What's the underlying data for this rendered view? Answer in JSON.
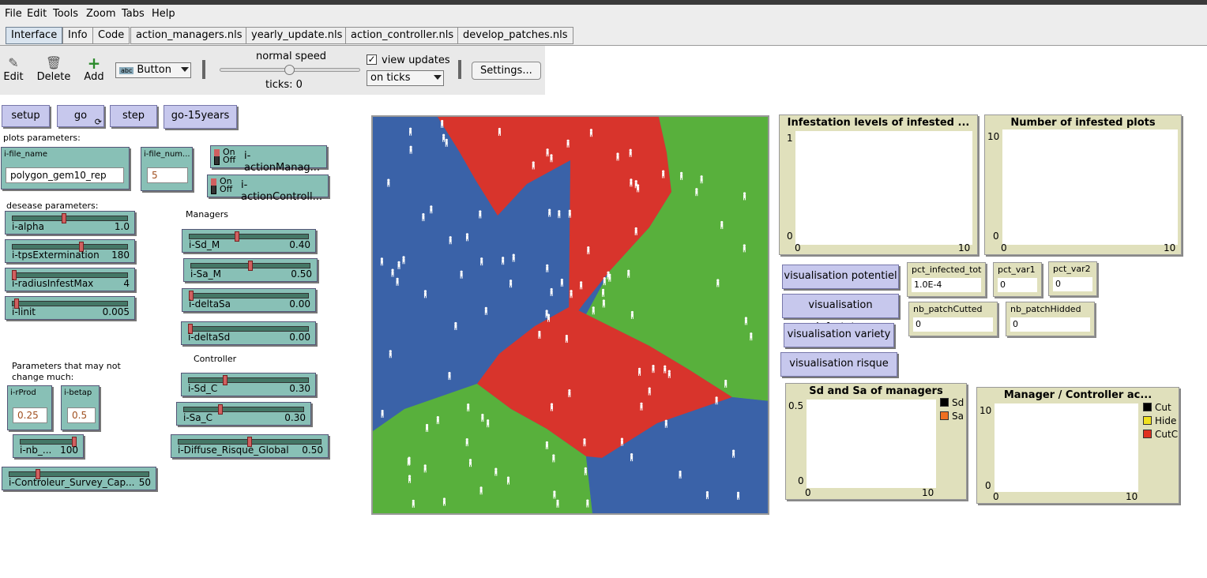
{
  "menu": [
    "File",
    "Edit",
    "Tools",
    "Zoom",
    "Tabs",
    "Help"
  ],
  "tabs": [
    "Interface",
    "Info",
    "Code",
    "action_managers.nls",
    "yearly_update.nls",
    "action_controller.nls",
    "develop_patches.nls"
  ],
  "toolbar": {
    "edit": "Edit",
    "delete": "Delete",
    "add": "Add",
    "widget_type": "Button",
    "speed_label": "normal speed",
    "ticks_label": "ticks: 0",
    "view_updates": "view updates",
    "update_mode": "on ticks",
    "settings": "Settings..."
  },
  "buttons": {
    "setup": "setup",
    "go": "go",
    "step": "step",
    "go15": "go-15years"
  },
  "labels": {
    "plots_params": "plots parameters:",
    "desease_params": "desease parameters:",
    "managers": "Managers",
    "controller": "Controller",
    "params_not_change_1": "Parameters that may not",
    "params_not_change_2": "change much:"
  },
  "chooser": {
    "title": "i-file_name",
    "value": "polygon_gem10_rep"
  },
  "inputs": [
    {
      "title": "i-file_num...",
      "value": "5"
    },
    {
      "title": "i-rProd",
      "value": "0.25"
    },
    {
      "title": "i-betap",
      "value": "0.5"
    }
  ],
  "switches": [
    {
      "on": "On",
      "off": "Off",
      "name": "i-actionManag..."
    },
    {
      "on": "On",
      "off": "Off",
      "name": "i-actionControll..."
    }
  ],
  "sliders": {
    "alpha": {
      "name": "i-alpha",
      "value": "1.0",
      "pos": 0.45
    },
    "tps": {
      "name": "i-tpsExtermination",
      "value": "180",
      "pos": 0.6
    },
    "radius": {
      "name": "i-radiusInfestMax",
      "value": "4",
      "pos": 0.0
    },
    "linit": {
      "name": "i-linit",
      "value": "0.005",
      "pos": 0.02
    },
    "sdm": {
      "name": "i-Sd_M",
      "value": "0.40",
      "pos": 0.4
    },
    "sam": {
      "name": "i-Sa_M",
      "value": "0.50",
      "pos": 0.5
    },
    "deltasa": {
      "name": "i-deltaSa",
      "value": "0.00",
      "pos": 0.0
    },
    "deltasd": {
      "name": "i-deltaSd",
      "value": "0.00",
      "pos": 0.0
    },
    "sdc": {
      "name": "i-Sd_C",
      "value": "0.30",
      "pos": 0.3
    },
    "sac": {
      "name": "i-Sa_C",
      "value": "0.30",
      "pos": 0.3
    },
    "diffuse": {
      "name": "i-Diffuse_Risque_Global",
      "value": "0.50",
      "pos": 0.5
    },
    "nb": {
      "name": "i-nb_...",
      "value": "100",
      "pos": 1.0
    },
    "survey": {
      "name": "i-Controleur_Survey_Cap...",
      "value": "50",
      "pos": 0.2
    }
  },
  "plots": {
    "infest": {
      "title": "Infestation levels of infested ...",
      "ymax": "1",
      "ymin": "0",
      "xmin": "0",
      "xmax": "10"
    },
    "number": {
      "title": "Number of infested plots",
      "ymax": "10",
      "ymin": "0",
      "xmin": "0",
      "xmax": "10"
    },
    "sdsa": {
      "title": "Sd and Sa of managers",
      "ymax": "0.5",
      "ymin": "0",
      "xmin": "0",
      "xmax": "10",
      "legend": [
        {
          "name": "Sd",
          "color": "#000000"
        },
        {
          "name": "Sa",
          "color": "#f07020"
        }
      ]
    },
    "actions": {
      "title": "Manager / Controller ac...",
      "ymax": "10",
      "ymin": "0",
      "xmin": "0",
      "xmax": "10",
      "legend": [
        {
          "name": "Cut",
          "color": "#000000"
        },
        {
          "name": "Hide",
          "color": "#f0e020"
        },
        {
          "name": "CutC",
          "color": "#e03020"
        }
      ]
    }
  },
  "vis_buttons": [
    "visualisation potentiel",
    "visualisation Infestat...",
    "visualisation variety",
    "visualisation risque"
  ],
  "monitors": [
    {
      "title": "pct_infected_tot",
      "value": "1.0E-4"
    },
    {
      "title": "pct_var1",
      "value": "0"
    },
    {
      "title": "pct_var2",
      "value": "0"
    },
    {
      "title": "nb_patchCutted",
      "value": "0"
    },
    {
      "title": "nb_patchHidded",
      "value": "0"
    }
  ],
  "colors": {
    "blue": "#3a62a8",
    "red": "#d8342c",
    "green": "#58b03c",
    "button": "#c7c8ed",
    "widget": "#88c0b6",
    "plot": "#e0e0bc"
  }
}
